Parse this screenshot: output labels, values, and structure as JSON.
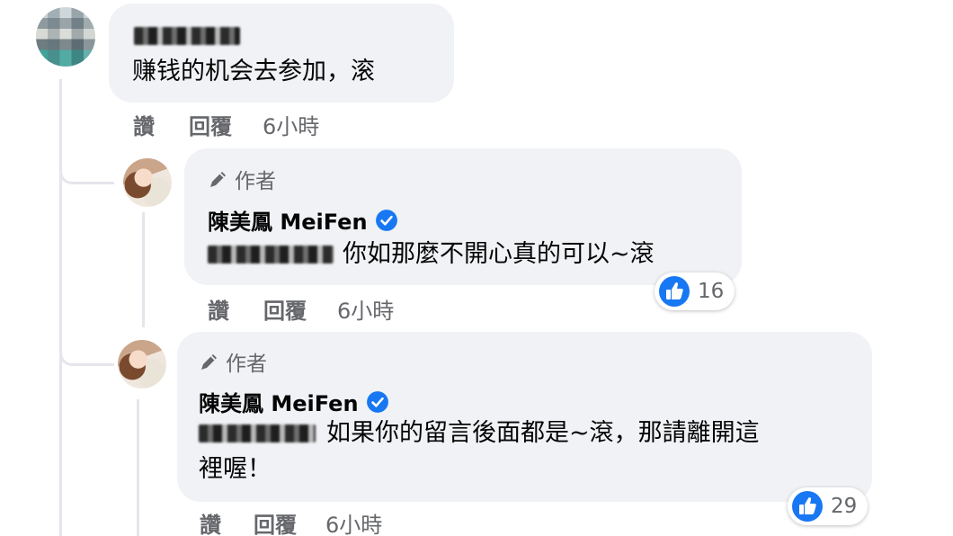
{
  "comments": [
    {
      "author_name": "",
      "text": "赚钱的机会去参加，滚",
      "actions": {
        "like": "讚",
        "reply": "回覆",
        "time": "6小時"
      }
    },
    {
      "author_badge": "作者",
      "author_name": "陳美鳳 MeiFen",
      "text": "你如那麼不開心真的可以~滾",
      "reaction_count": "16",
      "actions": {
        "like": "讚",
        "reply": "回覆",
        "time": "6小時"
      }
    },
    {
      "author_badge": "作者",
      "author_name": "陳美鳳 MeiFen",
      "text_line1": "如果你的留言後面都是~滾，那請離開這",
      "text_line2": "裡喔！",
      "reaction_count": "29",
      "actions": {
        "like": "讚",
        "reply": "回覆",
        "time": "6小時"
      }
    }
  ],
  "colors": {
    "bubble": "#f0f2f5",
    "secondary_text": "#65676b",
    "like_blue": "#1877f2",
    "verified_blue": "#1877f2"
  },
  "icons": [
    "pen-icon",
    "verified-badge-icon",
    "like-thumb-icon"
  ]
}
